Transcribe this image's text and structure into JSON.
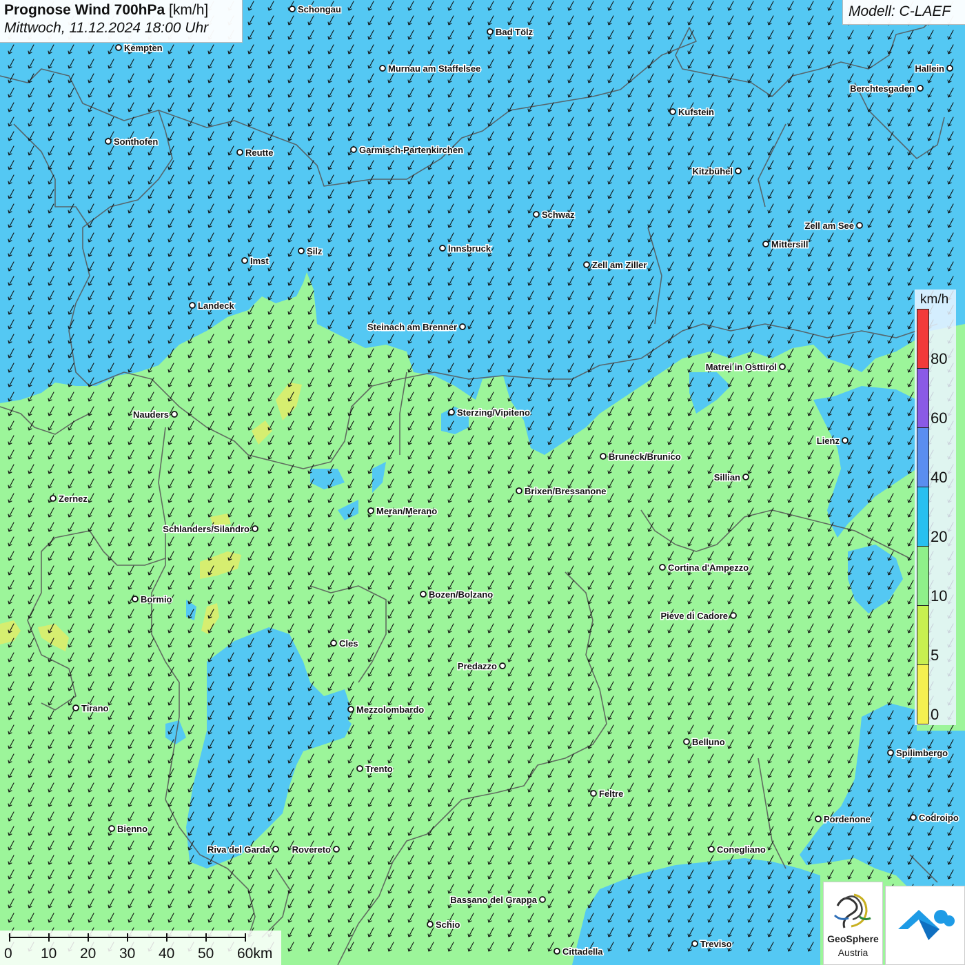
{
  "title": {
    "main": "Prognose Wind 700hPa",
    "unit": "[km/h]",
    "datetime": "Mittwoch, 11.12.2024 18:00 Uhr"
  },
  "model": "Modell: C-LAEF",
  "legend": {
    "unit": "km/h",
    "levels": [
      "80",
      "60",
      "40",
      "20",
      "10",
      "5",
      "0"
    ],
    "colors": [
      "#f23a3a",
      "#8a5ae6",
      "#5a8ef0",
      "#28c0f0",
      "#8ff08a",
      "#c8f050",
      "#f5f050"
    ]
  },
  "scale": {
    "labels": [
      "0",
      "10",
      "20",
      "30",
      "40",
      "50",
      "60km"
    ]
  },
  "fields": {
    "blue": "#54c8f3",
    "green": "#9cf59a",
    "yellow": "#d6ee70",
    "border_color": "#555555",
    "arrow_color": "#111111"
  },
  "wind_direction": "from north-east",
  "cities": [
    "Schongau",
    "Kempten",
    "Bad Tölz",
    "Murnau am Staffelsee",
    "Hallein",
    "Berchtesgaden",
    "Kufstein",
    "Sonthofen",
    "Reutte",
    "Garmisch-Partenkirchen",
    "Kitzbühel",
    "Schwaz",
    "Zell am See",
    "Mittersill",
    "Innsbruck",
    "Silz",
    "Imst",
    "Zell am Ziller",
    "Landeck",
    "Steinach am Brenner",
    "Matrei in Osttirol",
    "Nauders",
    "Sterzing/Vipiteno",
    "Lienz",
    "Bruneck/Brunico",
    "Sillian",
    "Brixen/Bressanone",
    "Zernez",
    "Meran/Merano",
    "Schlanders/Silandro",
    "Cortina d'Ampezzo",
    "Bozen/Bolzano",
    "Bormio",
    "Pieve di Cadore",
    "Cles",
    "Predazzo",
    "Tirano",
    "Mezzolombardo",
    "Belluno",
    "Spilimbergo",
    "Trento",
    "Feltre",
    "Pordenone",
    "Codroipo",
    "Bienno",
    "Riva del Garda",
    "Rovereto",
    "Conegliano",
    "Bassano del Grappa",
    "Schio",
    "Treviso",
    "Cittadella"
  ],
  "logos": {
    "geosphere_line1": "GeoSphere",
    "geosphere_line2": "Austria"
  }
}
